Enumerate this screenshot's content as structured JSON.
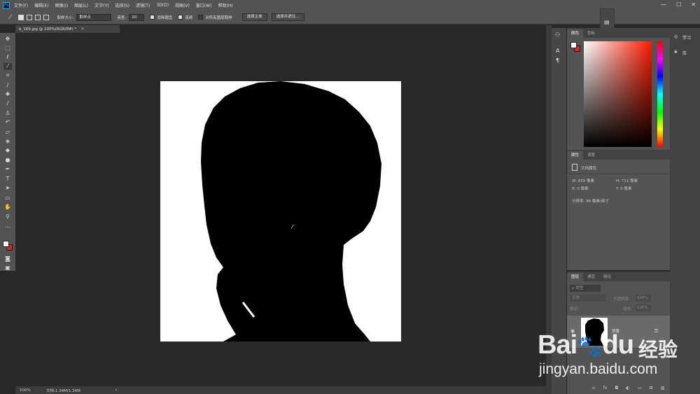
{
  "app": {
    "logo": "Ps"
  },
  "menu": [
    "文件(F)",
    "编辑(E)",
    "图像(I)",
    "图层(L)",
    "文字(Y)",
    "选择(S)",
    "滤镜(T)",
    "3D(D)",
    "视图(V)",
    "窗口(W)",
    "帮助(H)"
  ],
  "window_controls": {
    "minimize": "—",
    "maximize": "☐",
    "close": "✕"
  },
  "options": {
    "sample_size_label": "取样大小:",
    "sample_size_value": "取样点",
    "tolerance_label": "容差:",
    "tolerance_value": "20",
    "antialias_label": "消除锯齿",
    "contiguous_label": "连续",
    "sample_all_label": "对所有图层取样",
    "select_subject_label": "选择主体",
    "select_mask_label": "选择并遮住..."
  },
  "document": {
    "tab_label": "b_169.jpg @ 100%(RGB/8#) *",
    "tab_close": "×",
    "status_zoom": "100%",
    "status_doc": "文档:1.34M/1.34M",
    "status_arrow": "›"
  },
  "color_panel": {
    "tabs": [
      "颜色",
      "色板"
    ]
  },
  "properties_panel": {
    "tabs": [
      "属性",
      "调整"
    ],
    "section_title": "文档属性",
    "w": "W:  659 像素",
    "h": "H:  711 像素",
    "x": "X:  0 像素",
    "y": "Y:  0 像素",
    "resolution": "分辨率: 96 像素/英寸"
  },
  "layers_panel": {
    "tabs": [
      "图层",
      "通道",
      "路径"
    ],
    "filter_label": "ρ 类型",
    "blend_mode": "正常",
    "opacity_label": "不透明度:",
    "opacity_value": "100%",
    "lock_label": "锁定:",
    "fill_label": "填充:",
    "fill_value": "100%",
    "layer_name": "背景"
  },
  "learn_panel": {
    "learn_label": "学习",
    "library_label": "库"
  },
  "watermark": {
    "brand": "Bai",
    "brand_mid": "du",
    "cn": "经验",
    "url": "jingyan.baidu.com"
  },
  "colors": {
    "accent_red": "#e0201c",
    "panel": "#535353",
    "canvas_bg": "#282828"
  },
  "icons": [
    "ps-logo-icon",
    "move-icon",
    "marquee-icon",
    "lasso-icon",
    "magic-wand-icon",
    "crop-icon",
    "eyedropper-icon",
    "brush-icon",
    "text-icon",
    "hand-icon",
    "zoom-icon"
  ]
}
